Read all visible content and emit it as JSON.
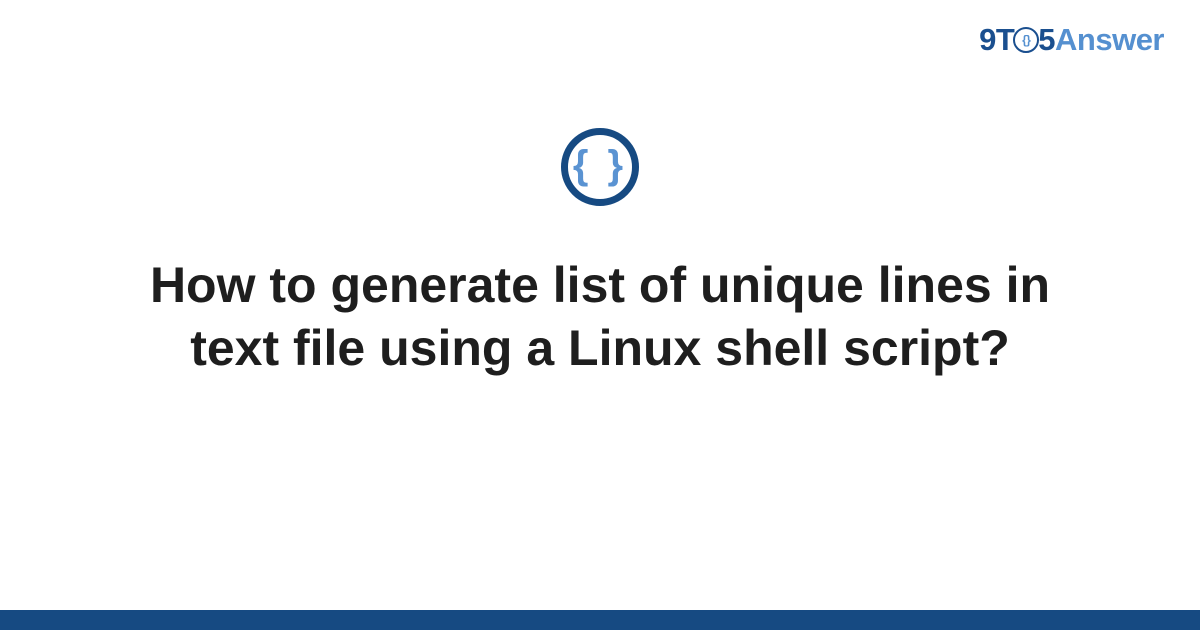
{
  "logo": {
    "part_9t": "9T",
    "part_o_inner": "{}",
    "part_5": "5",
    "part_answer": "Answer"
  },
  "badge": {
    "glyph": "{ }"
  },
  "title": "How to generate list of unique lines in text file using a Linux shell script?"
}
